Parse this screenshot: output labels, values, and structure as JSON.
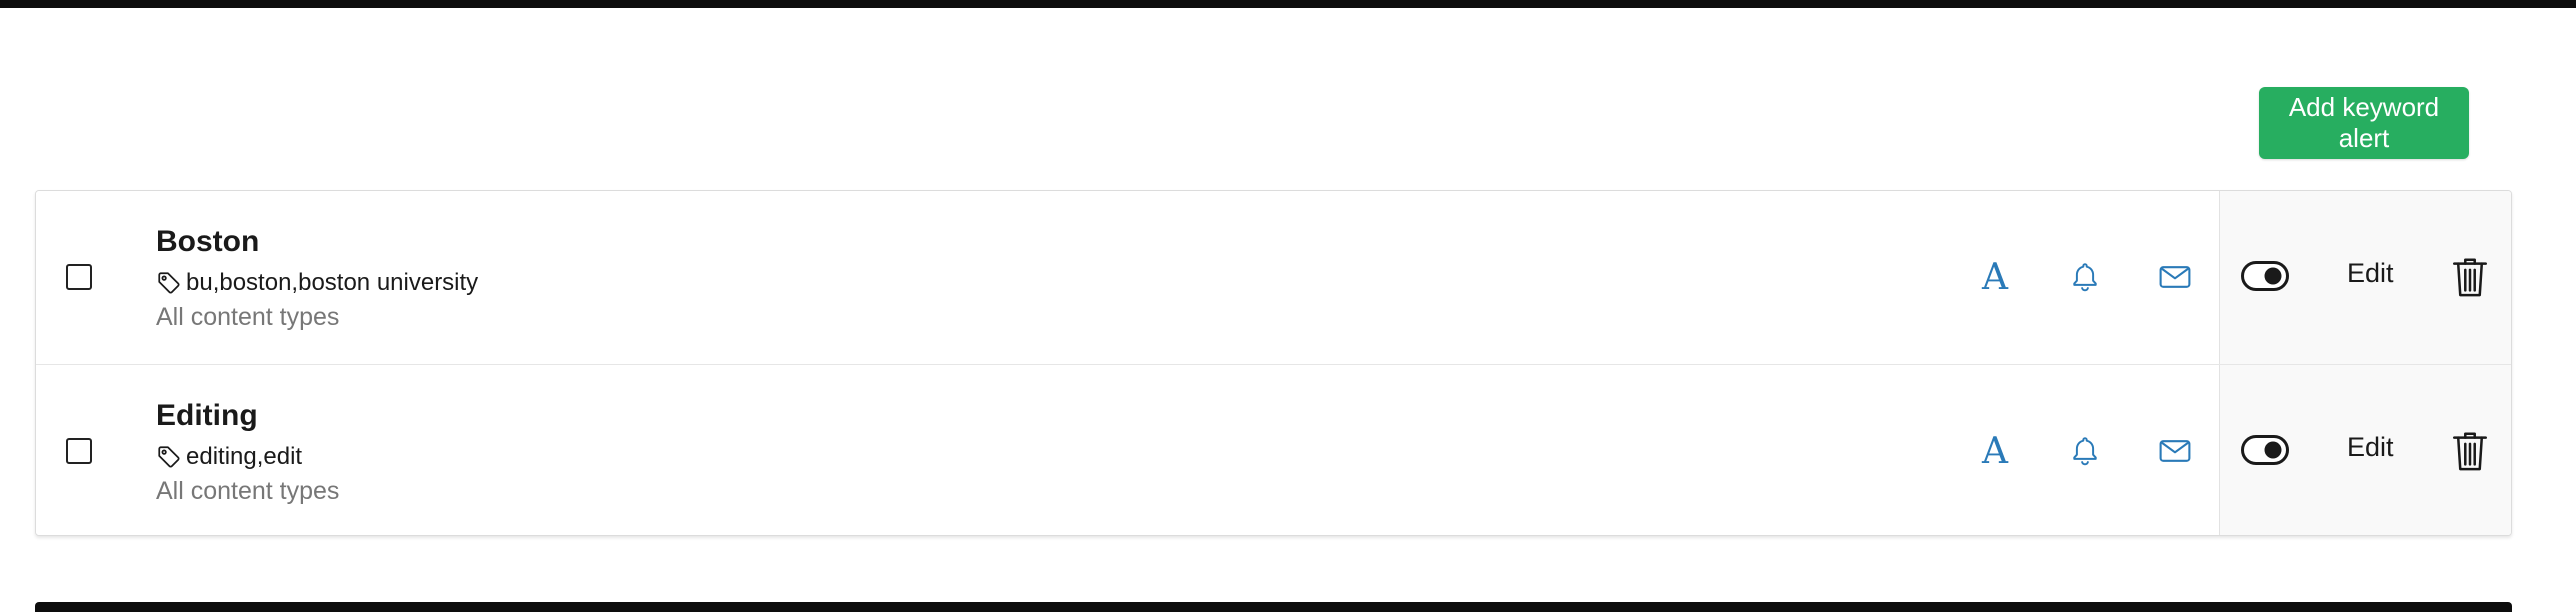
{
  "toolbar": {
    "add_label": "Add keyword alert",
    "add_color": "#27ae60"
  },
  "alerts": [
    {
      "title": "Boston",
      "keywords": "bu,boston,boston university",
      "content_types": "All content types",
      "font_glyph": "A",
      "edit_label": "Edit",
      "enabled": true
    },
    {
      "title": "Editing",
      "keywords": "editing,edit",
      "content_types": "All content types",
      "font_glyph": "A",
      "edit_label": "Edit",
      "enabled": true
    }
  ],
  "icons": {
    "tag": "tag-icon",
    "font": "font-icon",
    "bell": "bell-icon",
    "mail": "mail-icon",
    "toggle": "toggle-icon",
    "trash": "trash-icon"
  },
  "colors": {
    "icon_blue": "#2a7ab8",
    "muted_text": "#777777",
    "panel_bg": "#f9f9f9"
  }
}
